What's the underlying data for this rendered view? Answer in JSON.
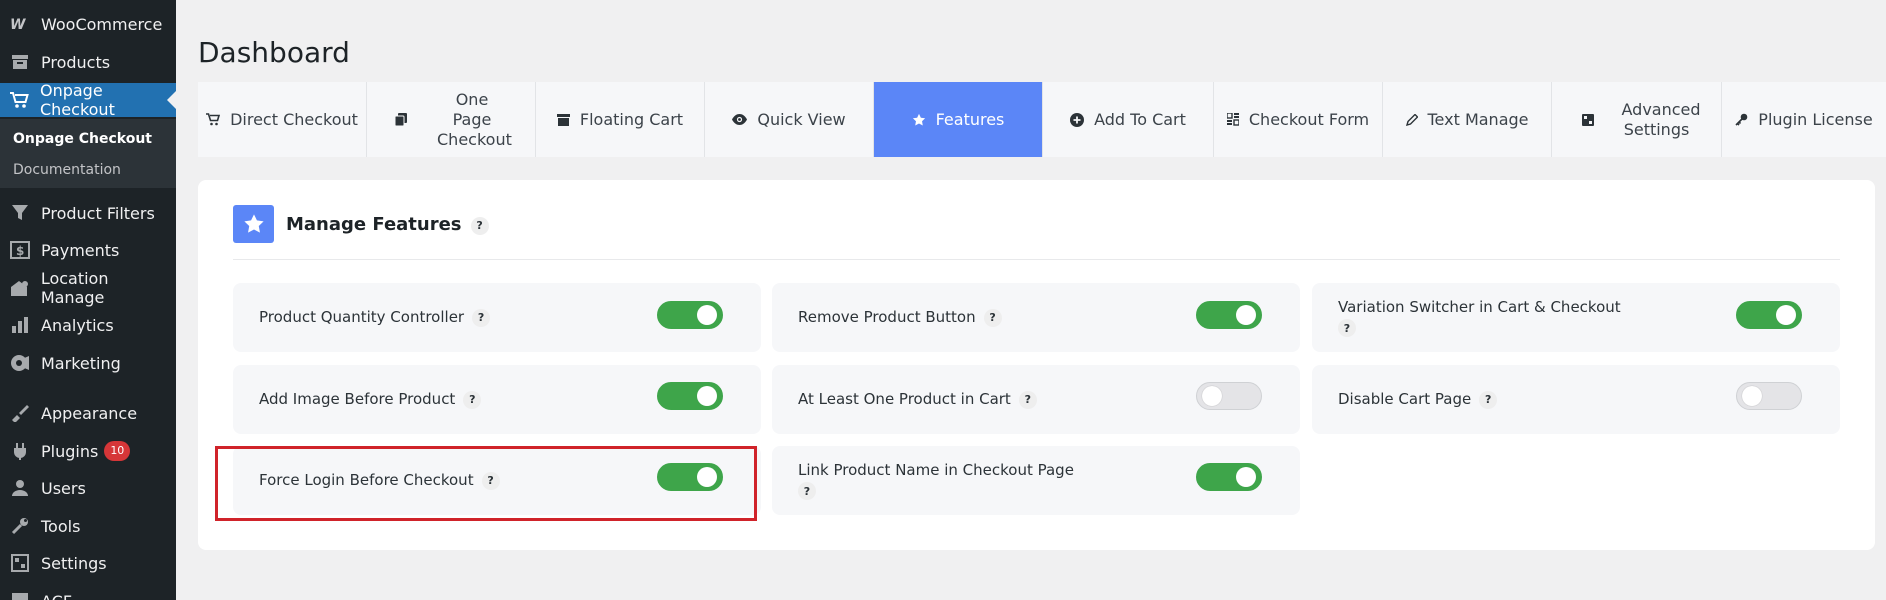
{
  "sidebar": {
    "items": [
      {
        "label": "WooCommerce",
        "icon": "woocommerce-icon"
      },
      {
        "label": "Products",
        "icon": "archive-icon"
      },
      {
        "label": "Onpage Checkout",
        "icon": "cart-icon"
      },
      {
        "label": "Product Filters",
        "icon": "filter-icon"
      },
      {
        "label": "Payments",
        "icon": "dollar-icon"
      },
      {
        "label": "Location Manage",
        "icon": "location-icon"
      },
      {
        "label": "Analytics",
        "icon": "chart-bar-icon"
      },
      {
        "label": "Marketing",
        "icon": "megaphone-icon"
      },
      {
        "label": "Appearance",
        "icon": "brush-icon"
      },
      {
        "label": "Plugins",
        "icon": "plugin-icon",
        "badge": "10"
      },
      {
        "label": "Users",
        "icon": "user-icon"
      },
      {
        "label": "Tools",
        "icon": "wrench-icon"
      },
      {
        "label": "Settings",
        "icon": "settings-icon"
      },
      {
        "label": "ACF",
        "icon": "grid-icon"
      }
    ],
    "submenu": [
      {
        "label": "Onpage Checkout"
      },
      {
        "label": "Documentation"
      }
    ]
  },
  "page": {
    "title": "Dashboard"
  },
  "tabs": [
    {
      "label": "Direct Checkout",
      "icon": "cart-icon"
    },
    {
      "label": "One Page Checkout",
      "icon": "copy-icon"
    },
    {
      "label": "Floating Cart",
      "icon": "archive-icon"
    },
    {
      "label": "Quick View",
      "icon": "eye-icon"
    },
    {
      "label": "Features",
      "icon": "star-icon",
      "active": true
    },
    {
      "label": "Add To Cart",
      "icon": "plus-circle-icon"
    },
    {
      "label": "Checkout Form",
      "icon": "form-icon"
    },
    {
      "label": "Text Manage",
      "icon": "pen-icon"
    },
    {
      "label": "Advanced Settings",
      "icon": "sliders-icon"
    },
    {
      "label": "Plugin License",
      "icon": "key-icon"
    }
  ],
  "panel": {
    "title": "Manage Features",
    "help": "?",
    "features": [
      {
        "label": "Product Quantity Controller",
        "enabled": true
      },
      {
        "label": "Remove Product Button",
        "enabled": true
      },
      {
        "label": "Variation Switcher in Cart & Checkout",
        "enabled": true
      },
      {
        "label": "Add Image Before Product",
        "enabled": true
      },
      {
        "label": "At Least One Product in Cart",
        "enabled": false
      },
      {
        "label": "Disable Cart Page",
        "enabled": false
      },
      {
        "label": "Force Login Before Checkout",
        "enabled": true
      },
      {
        "label": "Link Product Name in Checkout Page",
        "enabled": true
      }
    ]
  },
  "colors": {
    "sidebar_bg": "#1d2327",
    "sidebar_active": "#2271b1",
    "tab_active": "#5b86f7",
    "toggle_on": "#3ea54a",
    "highlight": "#d0232a"
  }
}
